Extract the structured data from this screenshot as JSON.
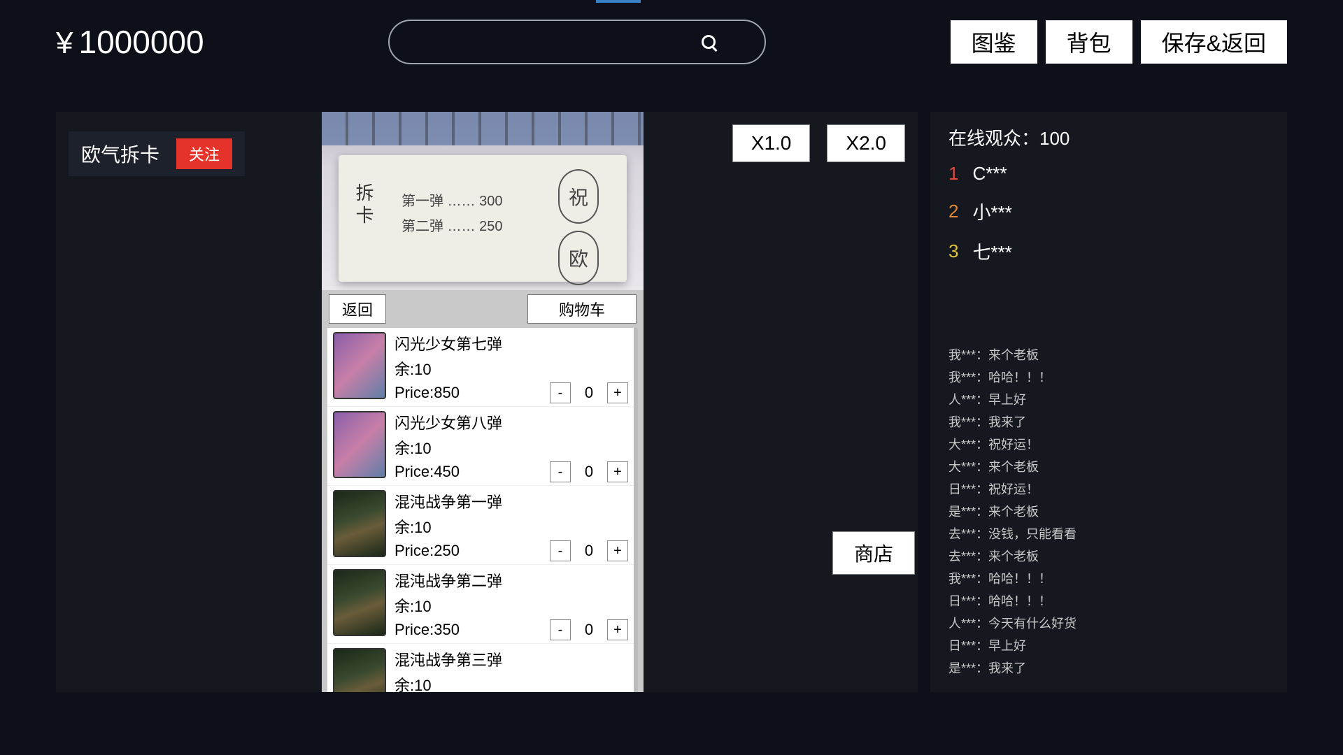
{
  "top": {
    "currency_symbol": "¥",
    "balance": "1000000",
    "nav": {
      "gallery": "图鉴",
      "bag": "背包",
      "save_return": "保存&返回"
    }
  },
  "stream": {
    "title": "欧气拆卡",
    "follow": "关注",
    "speed_x1": "X1.0",
    "speed_x2": "X2.0",
    "shop_button": "商店",
    "note": {
      "left": "拆卡",
      "line1": "第一弹 …… 300",
      "line2": "第二弹 …… 250",
      "seal1": "祝",
      "seal2": "欧"
    }
  },
  "shop": {
    "back": "返回",
    "cart": "购物车",
    "price_prefix": "Price:",
    "stock_prefix": "余:",
    "items": [
      {
        "name": "闪光少女第七弹",
        "stock": "10",
        "price": "850",
        "qty": "0",
        "thumb": "card"
      },
      {
        "name": "闪光少女第八弹",
        "stock": "10",
        "price": "450",
        "qty": "0",
        "thumb": "card"
      },
      {
        "name": "混沌战争第一弹",
        "stock": "10",
        "price": "250",
        "qty": "0",
        "thumb": "box"
      },
      {
        "name": "混沌战争第二弹",
        "stock": "10",
        "price": "350",
        "qty": "0",
        "thumb": "box"
      },
      {
        "name": "混沌战争第三弹",
        "stock": "10",
        "price": "",
        "qty": "",
        "thumb": "box"
      }
    ]
  },
  "chat": {
    "viewers_label": "在线观众：",
    "viewers_count": "100",
    "top": [
      {
        "rank": "1",
        "name": "C***"
      },
      {
        "rank": "2",
        "name": "小***"
      },
      {
        "rank": "3",
        "name": "七***"
      }
    ],
    "log": [
      "我***：来个老板",
      "我***：哈哈！！！",
      "人***：早上好",
      "我***：我来了",
      "大***：祝好运！",
      "大***：来个老板",
      "日***：祝好运！",
      "是***：来个老板",
      "去***：没钱，只能看看",
      "去***：来个老板",
      "我***：哈哈！！！",
      "日***：哈哈！！！",
      "人***：今天有什么好货",
      "日***：早上好",
      "是***：我来了"
    ]
  }
}
